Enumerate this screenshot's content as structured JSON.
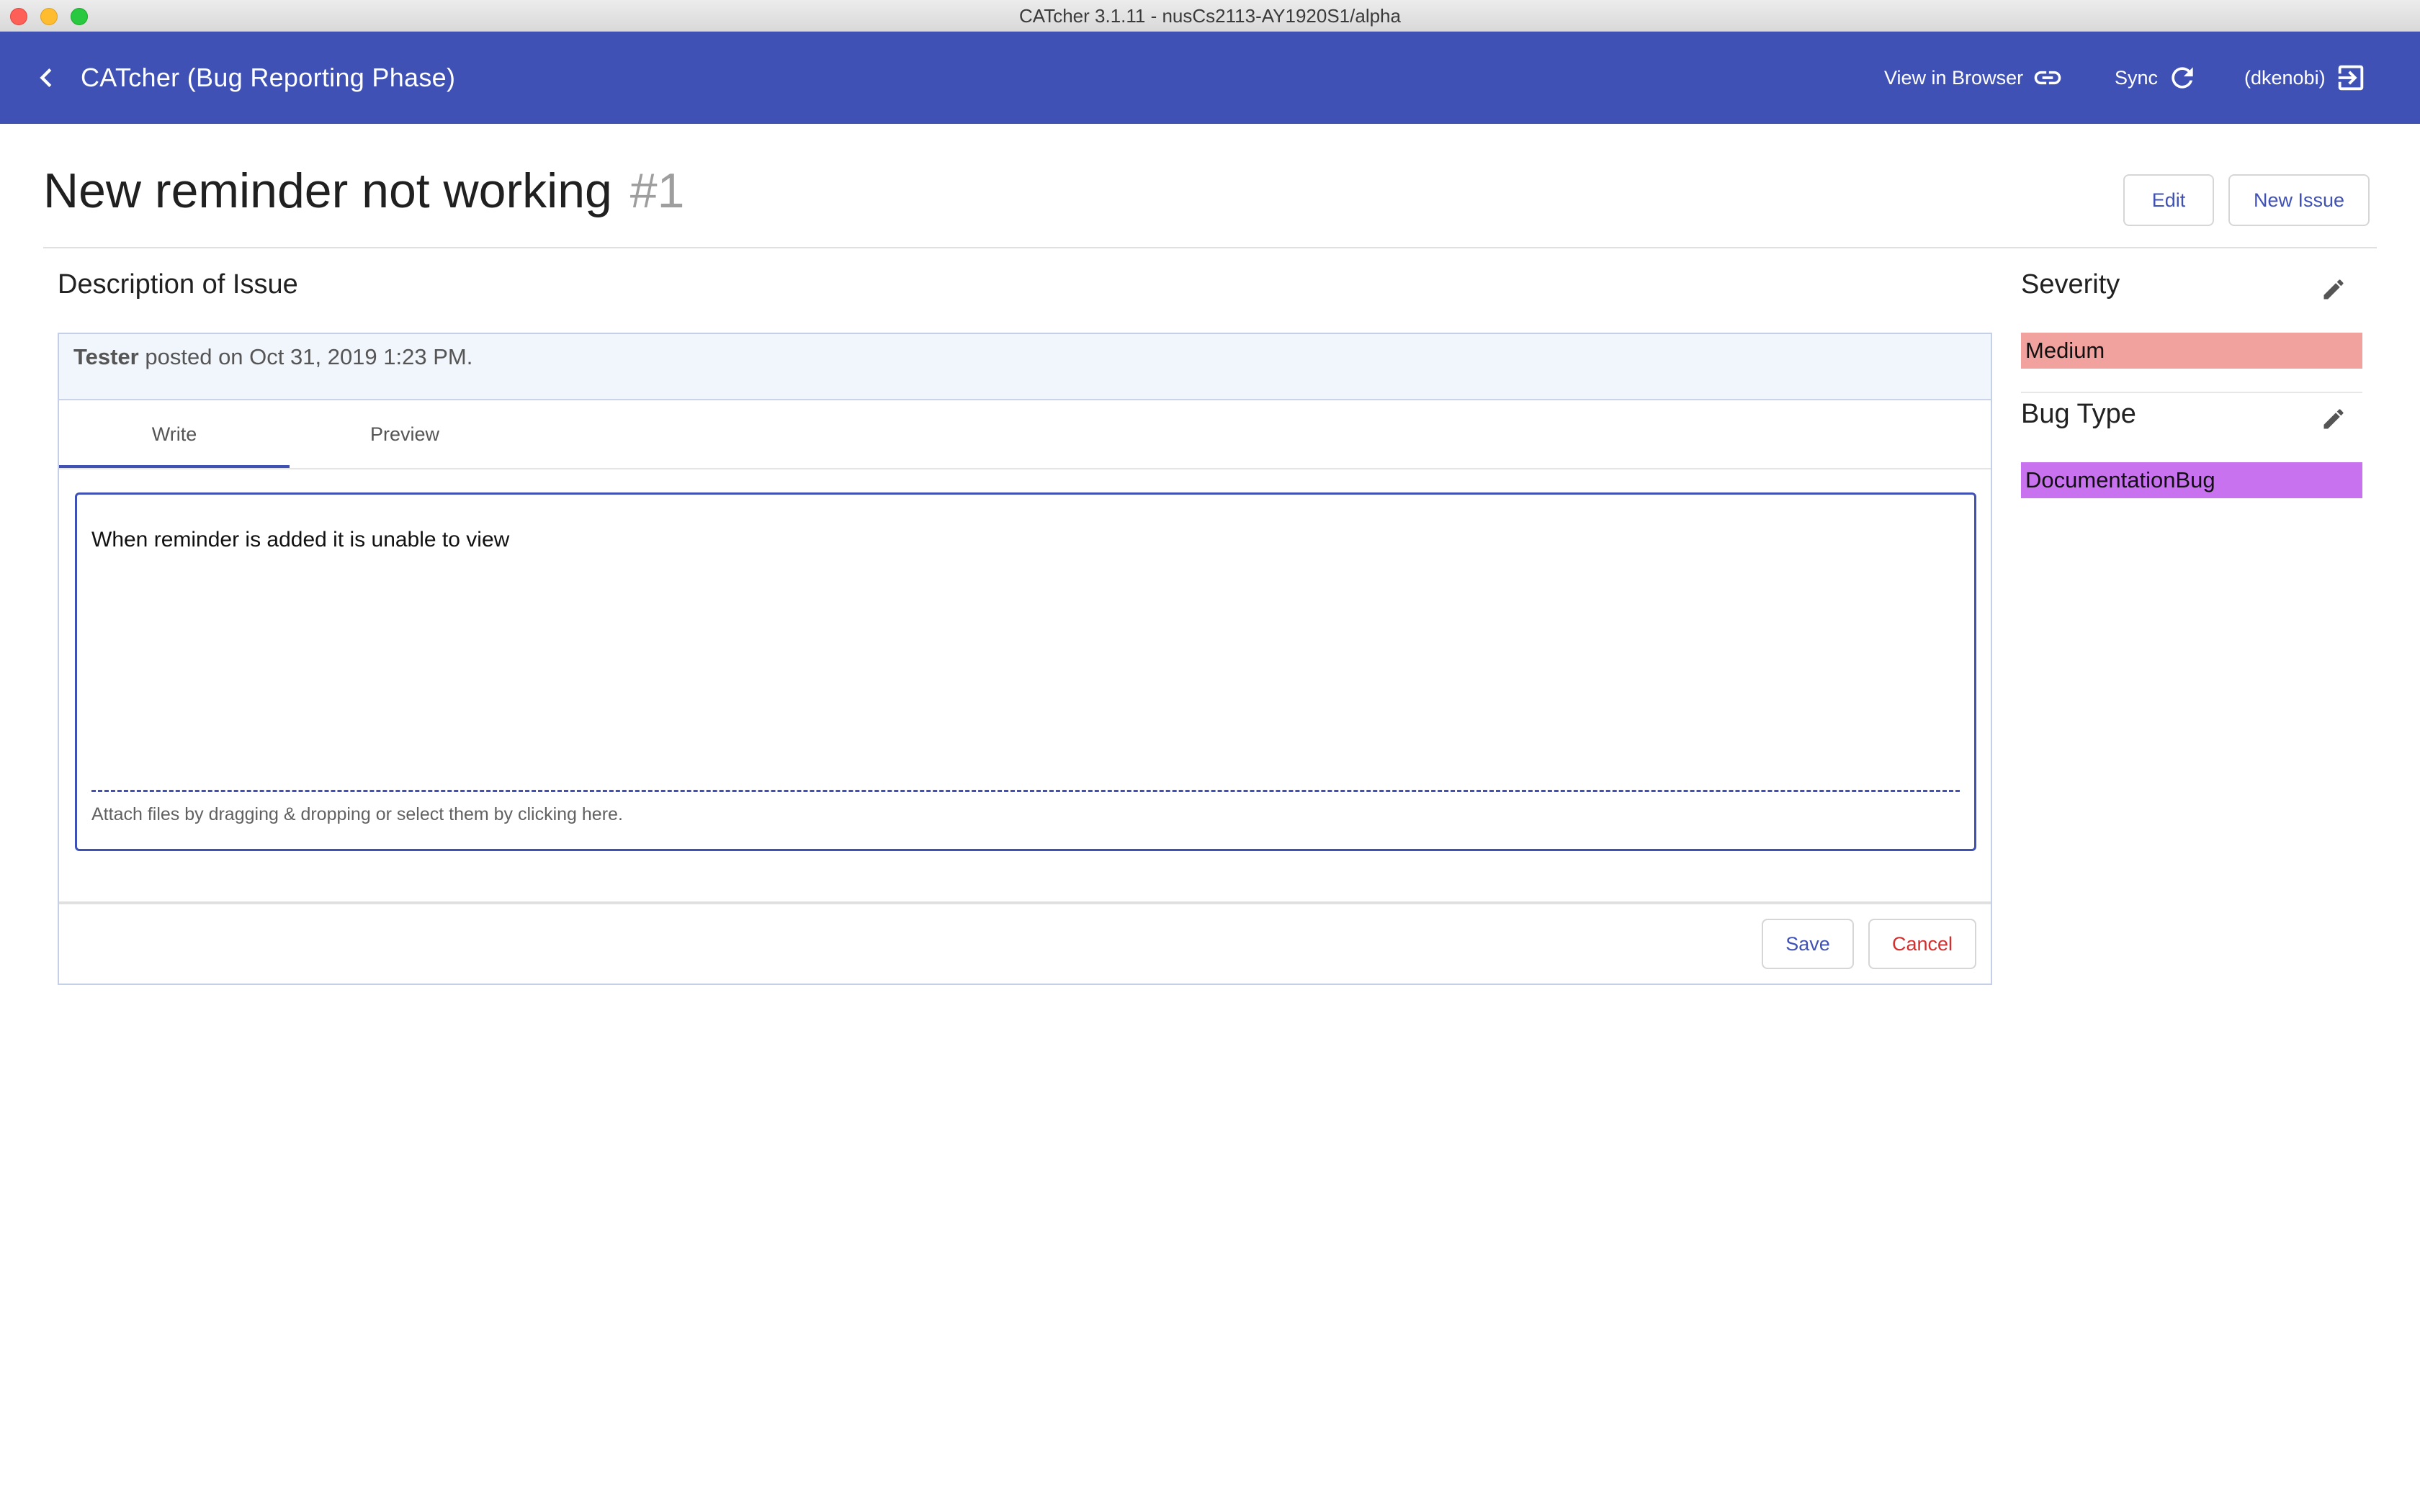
{
  "window": {
    "title": "CATcher 3.1.11 - nusCs2113-AY1920S1/alpha"
  },
  "toolbar": {
    "app_title": "CATcher  (Bug Reporting Phase)",
    "view_in_browser": "View in Browser",
    "sync": "Sync",
    "user": "(dkenobi)"
  },
  "issue": {
    "title": "New reminder not working",
    "number": "#1",
    "edit_label": "Edit",
    "new_issue_label": "New Issue"
  },
  "description": {
    "section_title": "Description of Issue",
    "author": "Tester",
    "posted": "posted on Oct 31, 2019 1:23 PM.",
    "tabs": [
      {
        "label": "Write"
      },
      {
        "label": "Preview"
      }
    ],
    "body": "When reminder is added it is unable to view",
    "attach_hint": "Attach files by dragging & dropping or select them by clicking here.",
    "save_label": "Save",
    "cancel_label": "Cancel"
  },
  "sidebar": {
    "severity_title": "Severity",
    "severity_value": "Medium",
    "severity_color": "#f1a29f",
    "bugtype_title": "Bug Type",
    "bugtype_value": "DocumentationBug",
    "bugtype_color": "#c972f0"
  },
  "colors": {
    "primary": "#3f51b5",
    "cancel": "#d32f2f"
  },
  "icons": {
    "back": "chevron-left-icon",
    "link": "link-icon",
    "sync": "refresh-icon",
    "logout": "logout-icon",
    "edit": "pencil-icon"
  }
}
